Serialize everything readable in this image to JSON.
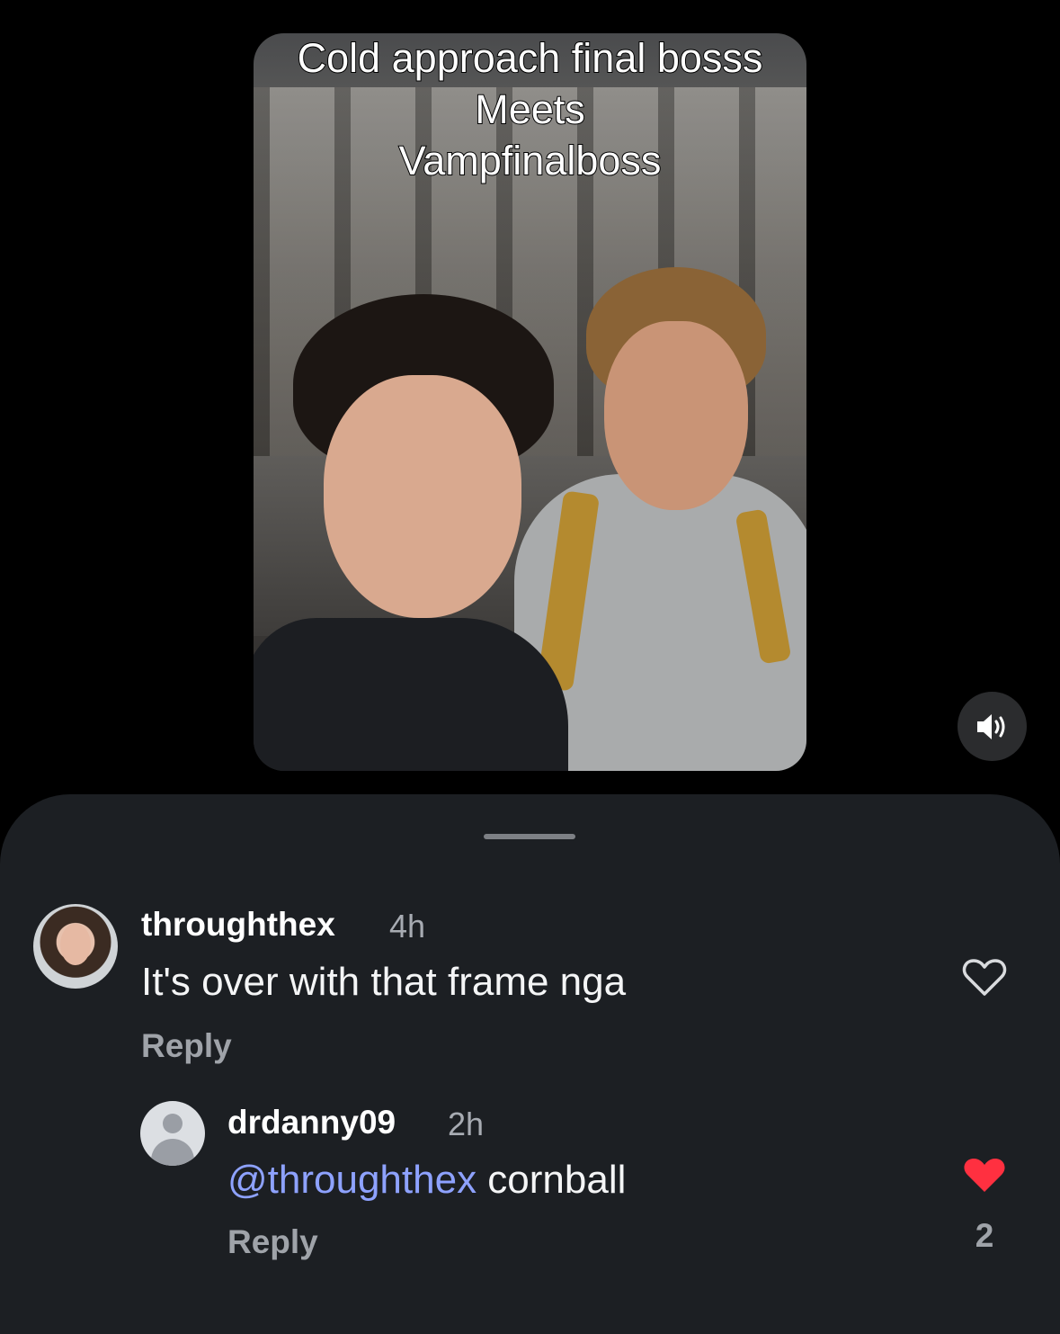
{
  "video": {
    "caption_lines": [
      "Cold approach final bosss",
      "Meets",
      "Vampfinalboss"
    ]
  },
  "volume": {
    "icon": "speaker-volume-icon"
  },
  "comments": [
    {
      "username": "throughthex",
      "time": "4h",
      "text": "It's over with that frame nga",
      "reply_label": "Reply",
      "liked": false,
      "like_count": ""
    },
    {
      "username": "drdanny09",
      "time": "2h",
      "mention": "@throughthex",
      "text": " cornball",
      "reply_label": "Reply",
      "liked": true,
      "like_count": "2"
    }
  ],
  "colors": {
    "sheet_bg": "#1c1f23",
    "mention": "#8ea2ff",
    "heart_liked": "#ff3040"
  }
}
